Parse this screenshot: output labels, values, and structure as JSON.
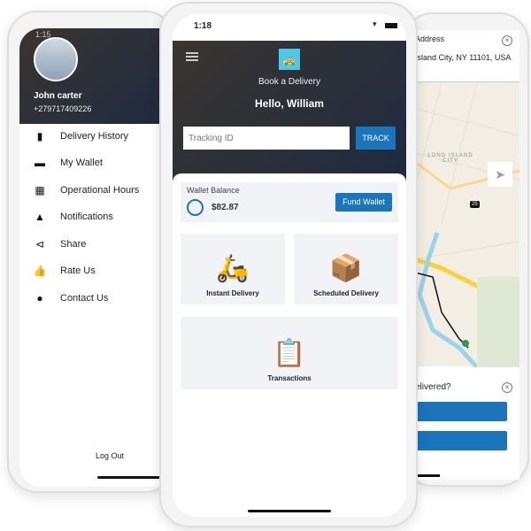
{
  "left_phone": {
    "time": "1:15",
    "user_name": "John carter",
    "phone": "+279717409226",
    "menu": [
      {
        "label": "Delivery History",
        "icon": "bookmark-icon"
      },
      {
        "label": "My Wallet",
        "icon": "wallet-icon"
      },
      {
        "label": "Operational Hours",
        "icon": "calendar-icon"
      },
      {
        "label": "Notifications",
        "icon": "bell-icon"
      },
      {
        "label": "Share",
        "icon": "share-icon"
      },
      {
        "label": "Rate Us",
        "icon": "thumbs-up-icon"
      },
      {
        "label": "Contact Us",
        "icon": "chat-icon"
      }
    ],
    "logout": "Log Out"
  },
  "middle_phone": {
    "time": "1:18",
    "app_title": "Book a Delivery",
    "greeting": "Hello, William",
    "tracking_placeholder": "Tracking ID",
    "track_button": "TRACK",
    "wallet": {
      "label": "Wallet Balance",
      "amount": "$82.87",
      "fund_button": "Fund Wallet"
    },
    "tiles": [
      {
        "label": "Instant Delivery",
        "icon": "scooter-icon"
      },
      {
        "label": "Scheduled Delivery",
        "icon": "package-clock-icon"
      },
      {
        "label": "Transactions",
        "icon": "clipboard-icon"
      }
    ],
    "accent": "#1a75bc"
  },
  "right_phone": {
    "address_label": "Address",
    "address_value": "Island City, NY 11101, USA",
    "map_label": "LONG ISLAND CITY",
    "route_badge": "25",
    "question": "elivered?"
  }
}
